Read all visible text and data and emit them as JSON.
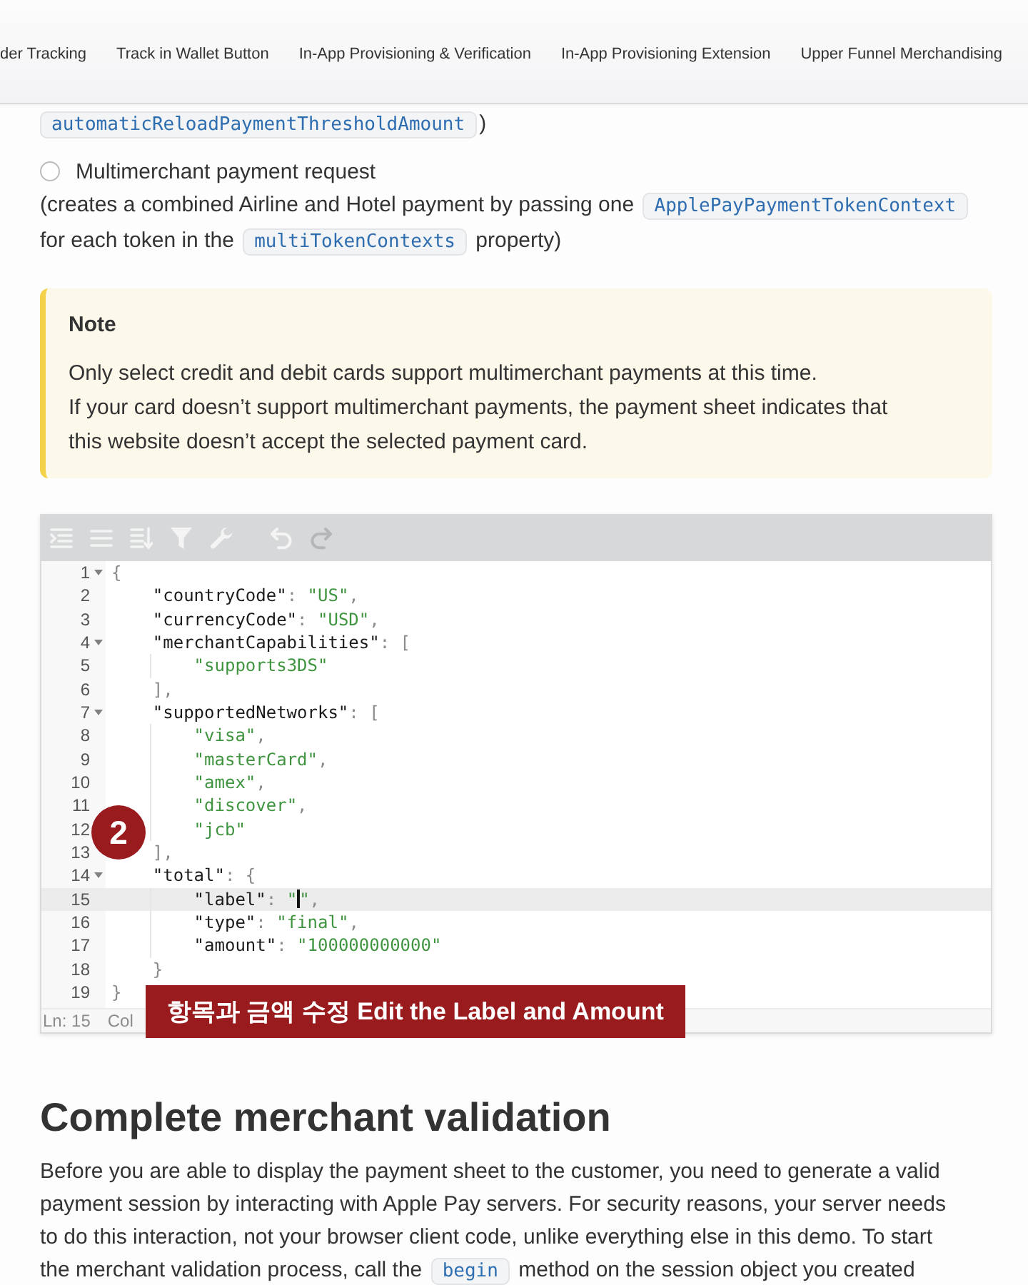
{
  "top_nav": {
    "links": [
      {
        "label": "der Tracking",
        "selected": false
      },
      {
        "label": "Track in Wallet Button",
        "selected": false
      },
      {
        "label": "In-App Provisioning & Verification",
        "selected": false
      },
      {
        "label": "In-App Provisioning Extension",
        "selected": false
      },
      {
        "label": "Upper Funnel Merchandising",
        "selected": false
      }
    ]
  },
  "fragment": {
    "segments": [
      {
        "kind": "code",
        "text": "automaticReloadPaymentThresholdAmount"
      },
      {
        "kind": "text",
        "text": ")"
      }
    ]
  },
  "option": {
    "label": "Multimerchant payment request",
    "checked": false,
    "description": [
      {
        "kind": "text",
        "text": "(creates a combined Airline and Hotel payment by passing one "
      },
      {
        "kind": "code",
        "text": "ApplePayPaymentTokenContext"
      },
      {
        "kind": "text",
        "text": " for each token in the "
      },
      {
        "kind": "code",
        "text": "multiTokenContexts"
      },
      {
        "kind": "text",
        "text": " property)"
      }
    ]
  },
  "note": {
    "title": "Note",
    "lines": [
      "Only select credit and debit cards support multimerchant payments at this time.",
      "If your card doesn’t support multimerchant payments, the payment sheet indicates that this website doesn’t accept the selected payment card."
    ]
  },
  "editor": {
    "toolbar": [
      {
        "kind": "format",
        "disabled": false
      },
      {
        "kind": "compact",
        "disabled": false
      },
      {
        "kind": "sort",
        "disabled": false
      },
      {
        "kind": "filter",
        "disabled": false
      },
      {
        "kind": "transform",
        "disabled": false
      },
      {
        "kind": "undo",
        "disabled": false
      },
      {
        "kind": "redo",
        "disabled": true
      }
    ],
    "lines": [
      {
        "number": "1",
        "active": false,
        "tokens": [
          {
            "kind": "punct",
            "text": "{"
          }
        ],
        "children": [
          {
            "number": "2",
            "active": false,
            "tokens": [
              {
                "kind": "key",
                "text": "\"countryCode\""
              },
              {
                "kind": "punct",
                "text": ": "
              },
              {
                "kind": "string",
                "text": "\"US\""
              },
              {
                "kind": "punct",
                "text": ","
              }
            ]
          },
          {
            "number": "3",
            "active": false,
            "tokens": [
              {
                "kind": "key",
                "text": "\"currencyCode\""
              },
              {
                "kind": "punct",
                "text": ": "
              },
              {
                "kind": "string",
                "text": "\"USD\""
              },
              {
                "kind": "punct",
                "text": ","
              }
            ]
          },
          {
            "number": "4",
            "active": false,
            "tokens": [
              {
                "kind": "key",
                "text": "\"merchantCapabilities\""
              },
              {
                "kind": "punct",
                "text": ": ["
              }
            ],
            "children": [
              {
                "number": "5",
                "active": false,
                "tokens": [
                  {
                    "kind": "string",
                    "text": "\"supports3DS\""
                  }
                ]
              }
            ]
          },
          {
            "number": "6",
            "active": false,
            "tokens": [
              {
                "kind": "punct",
                "text": "],"
              }
            ]
          },
          {
            "number": "7",
            "active": false,
            "tokens": [
              {
                "kind": "key",
                "text": "\"supportedNetworks\""
              },
              {
                "kind": "punct",
                "text": ": ["
              }
            ],
            "children": [
              {
                "number": "8",
                "active": false,
                "tokens": [
                  {
                    "kind": "string",
                    "text": "\"visa\""
                  },
                  {
                    "kind": "punct",
                    "text": ","
                  }
                ]
              },
              {
                "number": "9",
                "active": false,
                "tokens": [
                  {
                    "kind": "string",
                    "text": "\"masterCard\""
                  },
                  {
                    "kind": "punct",
                    "text": ","
                  }
                ]
              },
              {
                "number": "10",
                "active": false,
                "tokens": [
                  {
                    "kind": "string",
                    "text": "\"amex\""
                  },
                  {
                    "kind": "punct",
                    "text": ","
                  }
                ]
              },
              {
                "number": "11",
                "active": false,
                "tokens": [
                  {
                    "kind": "string",
                    "text": "\"discover\""
                  },
                  {
                    "kind": "punct",
                    "text": ","
                  }
                ]
              },
              {
                "number": "12",
                "active": false,
                "tokens": [
                  {
                    "kind": "string",
                    "text": "\"jcb\""
                  }
                ]
              }
            ]
          },
          {
            "number": "13",
            "active": false,
            "tokens": [
              {
                "kind": "punct",
                "text": "],"
              }
            ]
          },
          {
            "number": "14",
            "active": false,
            "tokens": [
              {
                "kind": "key",
                "text": "\"total\""
              },
              {
                "kind": "punct",
                "text": ": {"
              }
            ],
            "children": [
              {
                "number": "15",
                "active": true,
                "tokens": [
                  {
                    "kind": "key",
                    "text": "\"label\""
                  },
                  {
                    "kind": "punct",
                    "text": ": "
                  },
                  {
                    "kind": "string",
                    "text": "\""
                  },
                  {
                    "kind": "caret"
                  },
                  {
                    "kind": "string",
                    "text": "\""
                  },
                  {
                    "kind": "punct",
                    "text": ","
                  }
                ]
              },
              {
                "number": "16",
                "active": false,
                "tokens": [
                  {
                    "kind": "key",
                    "text": "\"type\""
                  },
                  {
                    "kind": "punct",
                    "text": ": "
                  },
                  {
                    "kind": "string",
                    "text": "\"final\""
                  },
                  {
                    "kind": "punct",
                    "text": ","
                  }
                ]
              },
              {
                "number": "17",
                "active": false,
                "tokens": [
                  {
                    "kind": "key",
                    "text": "\"amount\""
                  },
                  {
                    "kind": "punct",
                    "text": ": "
                  },
                  {
                    "kind": "string",
                    "text": "\"100000000000\""
                  }
                ]
              }
            ]
          },
          {
            "number": "18",
            "active": false,
            "tokens": [
              {
                "kind": "punct",
                "text": "}"
              }
            ]
          }
        ]
      },
      {
        "number": "19",
        "active": false,
        "tokens": [
          {
            "kind": "punct",
            "text": "}"
          }
        ]
      }
    ],
    "status": {
      "line": "Ln: 15",
      "column": "Col"
    },
    "step_badge": "2",
    "caption": "항목과 금액 수정 Edit the Label and Amount"
  },
  "section": {
    "heading": "Complete merchant validation",
    "body": [
      {
        "kind": "text",
        "text": "Before you are able to display the payment sheet to the customer, you need to generate a valid payment session by interacting with Apple Pay servers. For security reasons, your server needs to do this interaction, not your browser client code, unlike everything else in this demo. To start the merchant validation process, call the "
      },
      {
        "kind": "code",
        "text": "begin"
      },
      {
        "kind": "text",
        "text": " method on the session object you created"
      }
    ]
  }
}
